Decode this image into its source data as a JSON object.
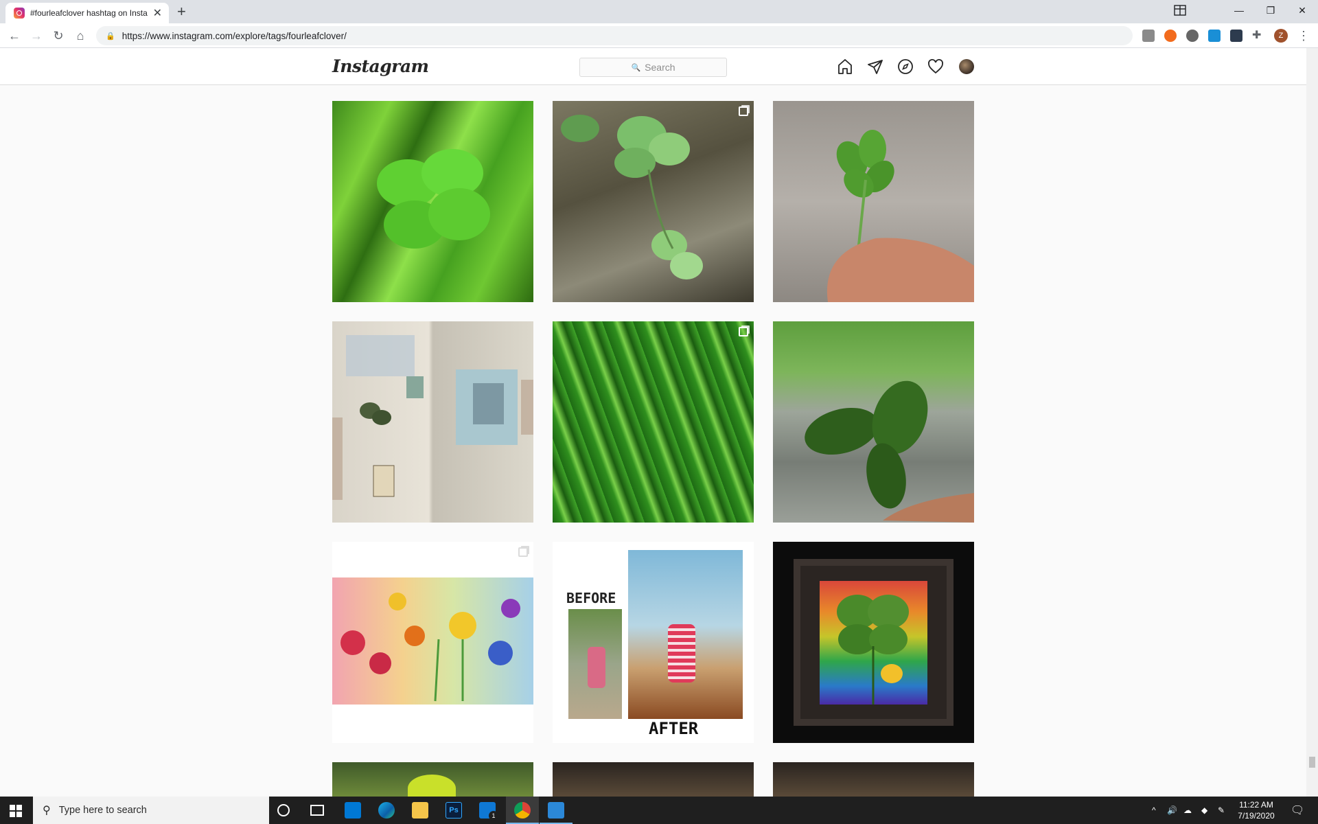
{
  "browser": {
    "tab_title": "#fourleafclover hashtag on Insta",
    "url": "https://www.instagram.com/explore/tags/fourleafclover/",
    "profile_initial": "Z"
  },
  "instagram": {
    "logo": "Instagram",
    "search_placeholder": "Search"
  },
  "posts": [
    {
      "id": "clover-grass",
      "multi": false
    },
    {
      "id": "clover-gravel",
      "multi": true
    },
    {
      "id": "clover-hand",
      "multi": false
    },
    {
      "id": "journal",
      "multi": false
    },
    {
      "id": "green-pattern",
      "multi": true
    },
    {
      "id": "clover-road",
      "multi": false
    },
    {
      "id": "flower-painting",
      "multi": true
    },
    {
      "id": "before-after",
      "multi": false,
      "text_before": "BEFORE",
      "text_after": "AFTER"
    },
    {
      "id": "framed-clover",
      "multi": false
    }
  ],
  "taskbar": {
    "search_placeholder": "Type here to search",
    "mail_badge": "1",
    "time": "11:22 AM",
    "date": "7/19/2020"
  }
}
